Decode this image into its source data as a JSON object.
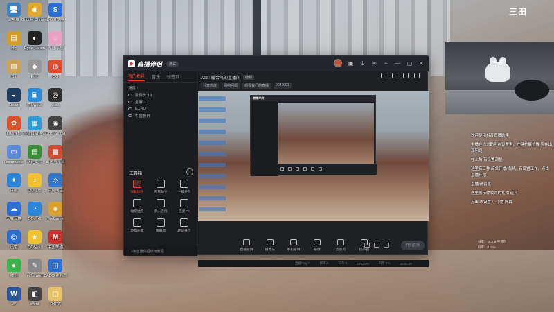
{
  "desktop": {
    "icons": [
      {
        "label": "此电脑",
        "glyph": "🖥",
        "color": "#3b82c4"
      },
      {
        "label": "Google Chrome",
        "glyph": "◉",
        "color": "#e0a82e"
      },
      {
        "label": "QQ浏览器",
        "glyph": "S",
        "color": "#2a6fd6"
      },
      {
        "label": "cfg",
        "glyph": "▤",
        "color": "#d39b2a"
      },
      {
        "label": "Egde Steam",
        "glyph": "◐",
        "color": "#222"
      },
      {
        "label": "哔哩哔哩",
        "glyph": "◌",
        "color": "#e9a3c0"
      },
      {
        "label": "Bit",
        "glyph": "▧",
        "color": "#caa15a"
      },
      {
        "label": "Epic",
        "glyph": "◆",
        "color": "#999"
      },
      {
        "label": "QQ",
        "glyph": "◍",
        "color": "#e04b2f"
      },
      {
        "label": "Steam",
        "glyph": "◒",
        "color": "#1f3d5c"
      },
      {
        "label": "腾讯会议",
        "glyph": "▣",
        "color": "#2b8bd8"
      },
      {
        "label": "OBS",
        "glyph": "◎",
        "color": "#333"
      },
      {
        "label": "直播伴侣",
        "glyph": "✿",
        "color": "#d8542c"
      },
      {
        "label": "抖音直播伴侣",
        "glyph": "▦",
        "color": "#2c9dd8"
      },
      {
        "label": "OBS Studio",
        "glyph": "◉",
        "color": "#444"
      },
      {
        "label": "Documents",
        "glyph": "▭",
        "color": "#5b8ad9"
      },
      {
        "label": "新建文件",
        "glyph": "▤",
        "color": "#3a8e3a"
      },
      {
        "label": "截图与平台",
        "glyph": "▩",
        "color": "#cc4d2f"
      },
      {
        "label": "百度",
        "glyph": "✦",
        "color": "#2c84d8"
      },
      {
        "label": "QQ音乐",
        "glyph": "♪",
        "color": "#f0c030"
      },
      {
        "label": "百度网盘",
        "glyph": "◇",
        "color": "#3478c9"
      },
      {
        "label": "天翼云盘",
        "glyph": "☁",
        "color": "#2c6fd0"
      },
      {
        "label": "QQ游戏",
        "glyph": "◔",
        "color": "#2c86d8"
      },
      {
        "label": "WeGame",
        "glyph": "◈",
        "color": "#d8a02c"
      },
      {
        "label": "迅雷",
        "glyph": "◎",
        "color": "#2c6fd0"
      },
      {
        "label": "QQ空间",
        "glyph": "★",
        "color": "#f2c330"
      },
      {
        "label": "中国联通",
        "glyph": "M",
        "color": "#c8302c"
      },
      {
        "label": "微信",
        "glyph": "●",
        "color": "#3ab34a"
      },
      {
        "label": "echo.png",
        "glyph": "✎",
        "color": "#888"
      },
      {
        "label": "CAD快速看图",
        "glyph": "◫",
        "color": "#2c6fd0"
      },
      {
        "label": "W",
        "glyph": "W",
        "color": "#2b579a"
      },
      {
        "label": "Word",
        "glyph": "◧",
        "color": "#444"
      },
      {
        "label": "文件夹",
        "glyph": "▢",
        "color": "#e8c46c"
      }
    ],
    "corner_logo": "三田"
  },
  "app": {
    "name": "直播伴侣",
    "badge": "测试",
    "left_tabs": [
      "我的场景",
      "音乐",
      "标签页"
    ],
    "scenes": [
      "摄像头 18",
      "全屏 1",
      "ECHO",
      "中窗投屏"
    ],
    "scene_header": "场景 1",
    "tools_title": "工具箱",
    "tools": [
      {
        "label": "弹幕助手",
        "active": true
      },
      {
        "label": "房管助手",
        "active": false
      },
      {
        "label": "主播任务",
        "active": false
      },
      {
        "label": "福袋抽奖",
        "active": false
      },
      {
        "label": "多人连线",
        "active": false
      },
      {
        "label": "连麦PK",
        "active": false
      },
      {
        "label": "虚拟形象",
        "active": false
      },
      {
        "label": "弹幕墙",
        "active": false
      },
      {
        "label": "歌词展示",
        "active": false
      }
    ],
    "footer_text": "3条直播伴侣使用教程",
    "room_title": "Azz : 暖合气的直播间",
    "room_edit": "编辑",
    "tags": [
      "分享热度",
      "网络问题",
      "观看我们的直播",
      "0047001"
    ],
    "bottom_items": [
      "直播投屏",
      "摄像头",
      "手机投屏",
      "录屏",
      "麦克风",
      "扬声器"
    ],
    "start_label": "开始直播",
    "status_items": [
      "直播Ping:0",
      "帧率:0",
      "码率:0",
      "CPU:0%",
      "内存:0%",
      "00:00:00"
    ]
  },
  "chat": {
    "lines": [
      "欢迎使用抖音直播助手",
      "主播在线求助可在设置里，左键扩展位置 实在出现问题",
      "在上角 有设置调整",
      "这里有三种 简单开播/横屏，有设置工作，点击直播开始",
      "直播 请留意",
      "这里展示你收到的礼物 道具",
      "点击 未设置 小礼物 屏幕"
    ],
    "corner_info": [
      "帧率：28.0 B 不可用",
      "码率：0 kb/s"
    ]
  }
}
